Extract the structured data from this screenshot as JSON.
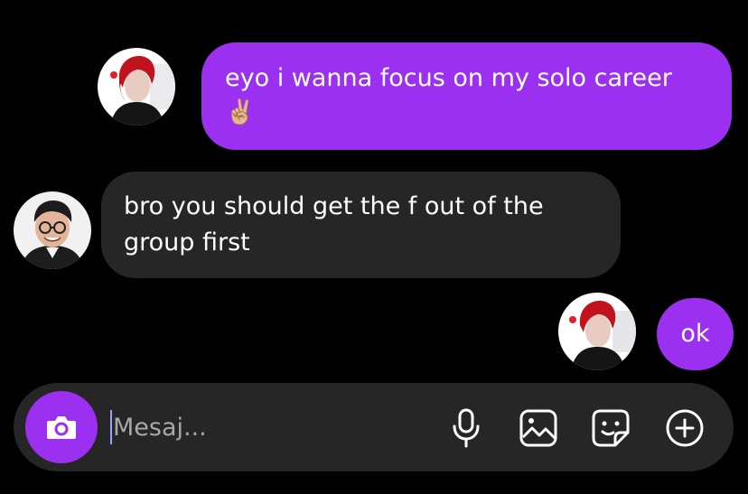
{
  "colors": {
    "background": "#000000",
    "sent_bubble": "#9b30f0",
    "received_bubble": "#262626",
    "composer": "#262626",
    "text": "#ffffff",
    "placeholder": "#a8a8a8"
  },
  "messages": [
    {
      "sender": "self",
      "text": "eyo i wanna focus on my solo career",
      "emoji": "✌🏼"
    },
    {
      "sender": "other",
      "text": "bro you should get the f out of the group first"
    },
    {
      "sender": "self",
      "text": "ok"
    }
  ],
  "composer": {
    "placeholder": "Mesaj...",
    "camera_icon": "camera-icon",
    "tools": [
      "microphone-icon",
      "gallery-icon",
      "sticker-icon",
      "plus-icon"
    ]
  }
}
